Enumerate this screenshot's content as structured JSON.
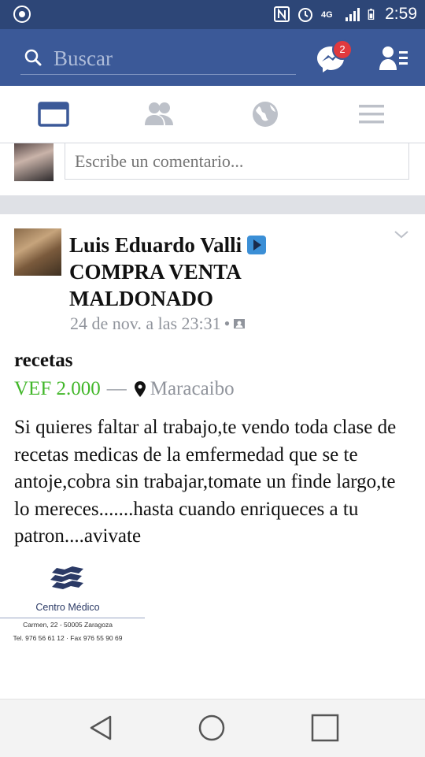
{
  "status_bar": {
    "time": "2:59",
    "icons": [
      "app-notification-icon",
      "nfc-icon",
      "alarm-icon",
      "4g-icon",
      "signal-icon",
      "battery-icon"
    ]
  },
  "header": {
    "search_placeholder": "Buscar",
    "messenger_badge": "2",
    "colors": {
      "bar": "#3b5998",
      "status_bar": "#2d4677",
      "badge": "#e0393e"
    }
  },
  "tabs": [
    {
      "icon": "news-feed-icon",
      "active": true
    },
    {
      "icon": "friends-icon",
      "active": false
    },
    {
      "icon": "globe-icon",
      "active": false
    },
    {
      "icon": "menu-icon",
      "active": false
    }
  ],
  "comment_box": {
    "placeholder": "Escribe un comentario..."
  },
  "post": {
    "author_line1": "Luis Eduardo Valli",
    "author_line2": "COMPRA VENTA",
    "author_line3": "MALDONADO",
    "timestamp": "24 de nov. a las 23:31",
    "separator": "•",
    "title": "recetas",
    "price": "VEF 2.000",
    "dash": "—",
    "location": "Maracaibo",
    "price_color": "#42b72a",
    "body": "Si quieres faltar al trabajo,te vendo toda clase de recetas medicas de la emfermedad que se te antoje,cobra sin trabajar,tomate un finde largo,te lo mereces.......hasta cuando enriqueces a tu patron....avivate",
    "image": {
      "title": "Centro Médico",
      "line1": "Carmen, 22 - 50005 Zaragoza",
      "line2": "Tel. 976 56 61 12 · Fax 976 55 90 69"
    }
  },
  "nav": [
    "back-icon",
    "home-icon",
    "recents-icon"
  ]
}
